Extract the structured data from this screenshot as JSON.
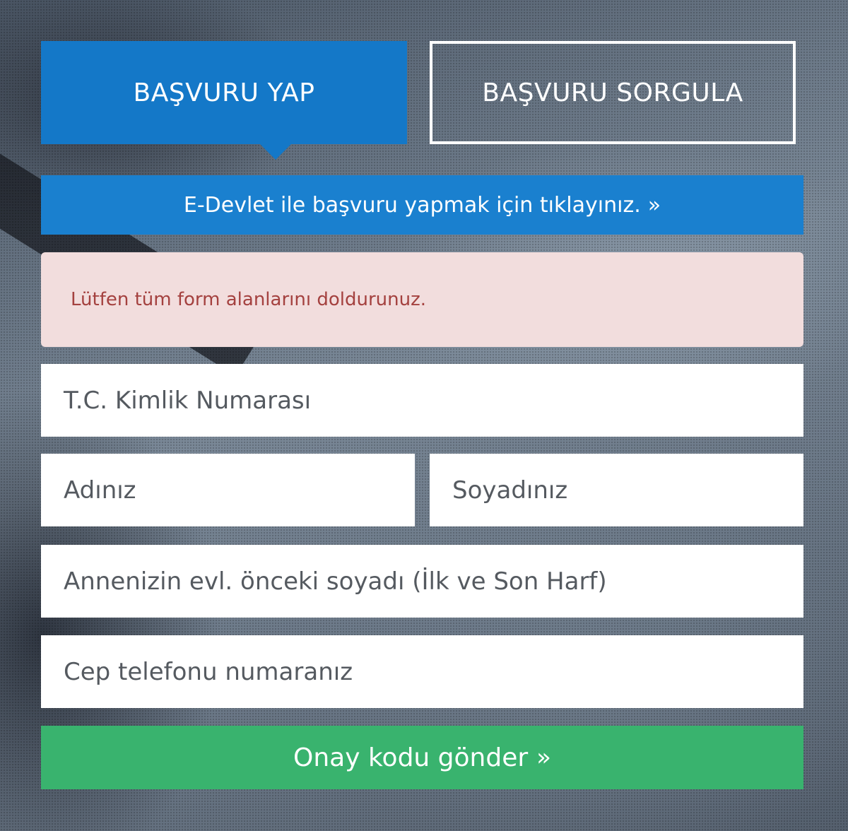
{
  "tabs": {
    "apply": "BAŞVURU YAP",
    "query": "BAŞVURU SORGULA"
  },
  "edevlet": {
    "text": "E-Devlet ile başvuru yapmak için tıklayınız.",
    "icon": "chevron-double-right-icon"
  },
  "alert": {
    "message": "Lütfen tüm form alanlarını doldurunuz."
  },
  "form": {
    "tc_placeholder": "T.C. Kimlik Numarası",
    "first_name_placeholder": "Adınız",
    "last_name_placeholder": "Soyadınız",
    "mother_maiden_placeholder": "Annenizin evl. önceki soyadı (İlk ve Son Harf)",
    "phone_placeholder": "Cep telefonu numaranız"
  },
  "submit": {
    "label": "Onay kodu gönder",
    "icon": "chevron-double-right-icon"
  },
  "colors": {
    "tab_active": "#1478c8",
    "edevlet_bar": "#1a80cf",
    "alert_bg": "#f2dddd",
    "alert_text": "#a4413f",
    "submit_bg": "#39b36e"
  }
}
